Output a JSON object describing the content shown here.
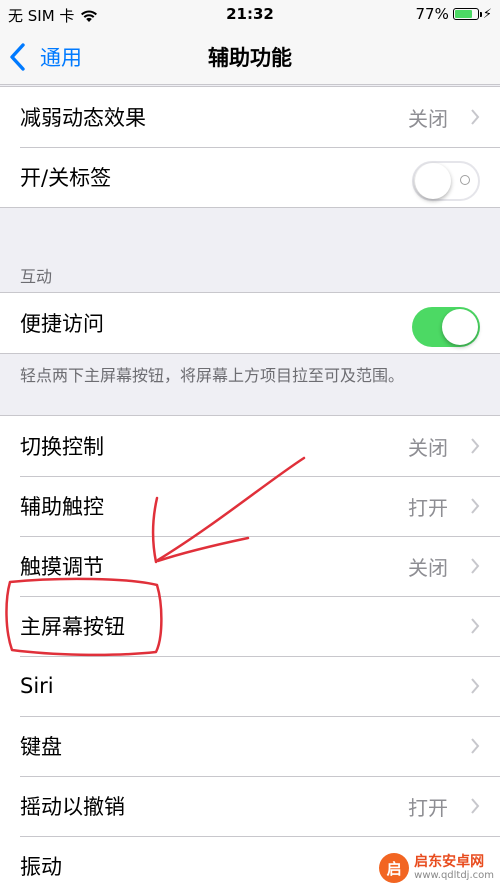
{
  "status_bar": {
    "carrier": "无 SIM 卡",
    "time": "21:32",
    "battery_percent": "77%",
    "battery_level": 0.77
  },
  "nav": {
    "back_label": "通用",
    "title": "辅助功能"
  },
  "group_top": {
    "rows": [
      {
        "label": "减弱动态效果",
        "value": "关闭"
      },
      {
        "label": "开/关标签",
        "toggle": "off"
      }
    ]
  },
  "interaction": {
    "header": "互动",
    "reachability_label": "便捷访问",
    "reachability_toggle": "on",
    "footer": "轻点两下主屏幕按钮，将屏幕上方项目拉至可及范围。"
  },
  "group_bottom": {
    "rows": [
      {
        "label": "切换控制",
        "value": "关闭"
      },
      {
        "label": "辅助触控",
        "value": "打开"
      },
      {
        "label": "触摸调节",
        "value": "关闭"
      },
      {
        "label": "主屏幕按钮",
        "value": ""
      },
      {
        "label": "Siri",
        "value": ""
      },
      {
        "label": "键盘",
        "value": ""
      },
      {
        "label": "摇动以撤销",
        "value": "打开"
      },
      {
        "label": "振动",
        "value": ""
      }
    ]
  },
  "watermark": {
    "logo_glyph": "启",
    "name": "启东安卓网",
    "url": "www.qdltdj.com"
  },
  "colors": {
    "accent": "#007aff",
    "toggle_on": "#4cd964",
    "annotation": "#e0303a"
  }
}
